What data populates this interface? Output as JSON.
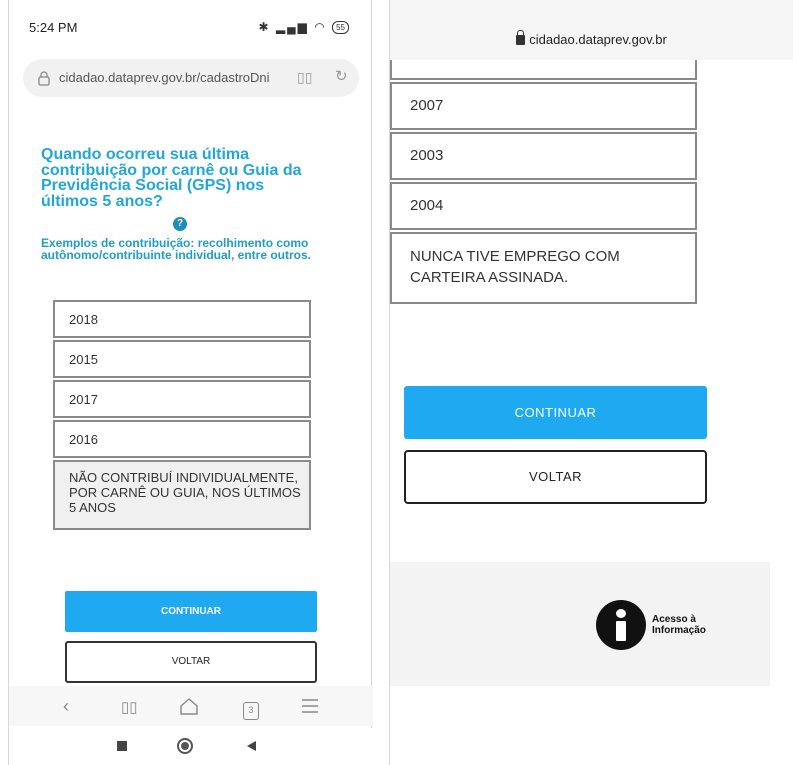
{
  "left": {
    "status_time": "5:24 PM",
    "status_battery": "55",
    "url": "cidadao.dataprev.gov.br/cadastroDni",
    "question": "Quando ocorreu sua última contribuição por carnê ou Guia da Previdência Social (GPS) nos últimos 5 anos?",
    "help_glyph": "?",
    "examples": "Exemplos de contribuição: recolhimento como autônomo/contribuinte individual, entre outros.",
    "options": [
      "2018",
      "2015",
      "2017",
      "2016"
    ],
    "option_none": "NÃO CONTRIBUÍ INDIVIDUALMENTE, POR CARNÊ OU GUIA, NOS ÚLTIMOS 5 ANOS",
    "continue_label": "CONTINUAR",
    "back_label": "VOLTAR",
    "tab_count": "3",
    "icons": {
      "lock": "lock-icon",
      "reader": "reader-mode-icon",
      "reload": "reload-icon",
      "back": "back-arrow-icon",
      "bookmarks": "bookmarks-icon",
      "home": "home-icon",
      "tabs": "tabs-icon",
      "menu": "menu-icon"
    }
  },
  "right": {
    "url": "cidadao.dataprev.gov.br",
    "options": [
      "2007",
      "2003",
      "2004"
    ],
    "option_none": "NUNCA TIVE EMPREGO COM CARTEIRA ASSINADA.",
    "continue_label": "CONTINUAR",
    "back_label": "VOLTAR",
    "access_line1": "Acesso à",
    "access_line2": "Informação"
  },
  "colors": {
    "accent": "#22a7d8",
    "button_blue": "#1fa9f0"
  }
}
